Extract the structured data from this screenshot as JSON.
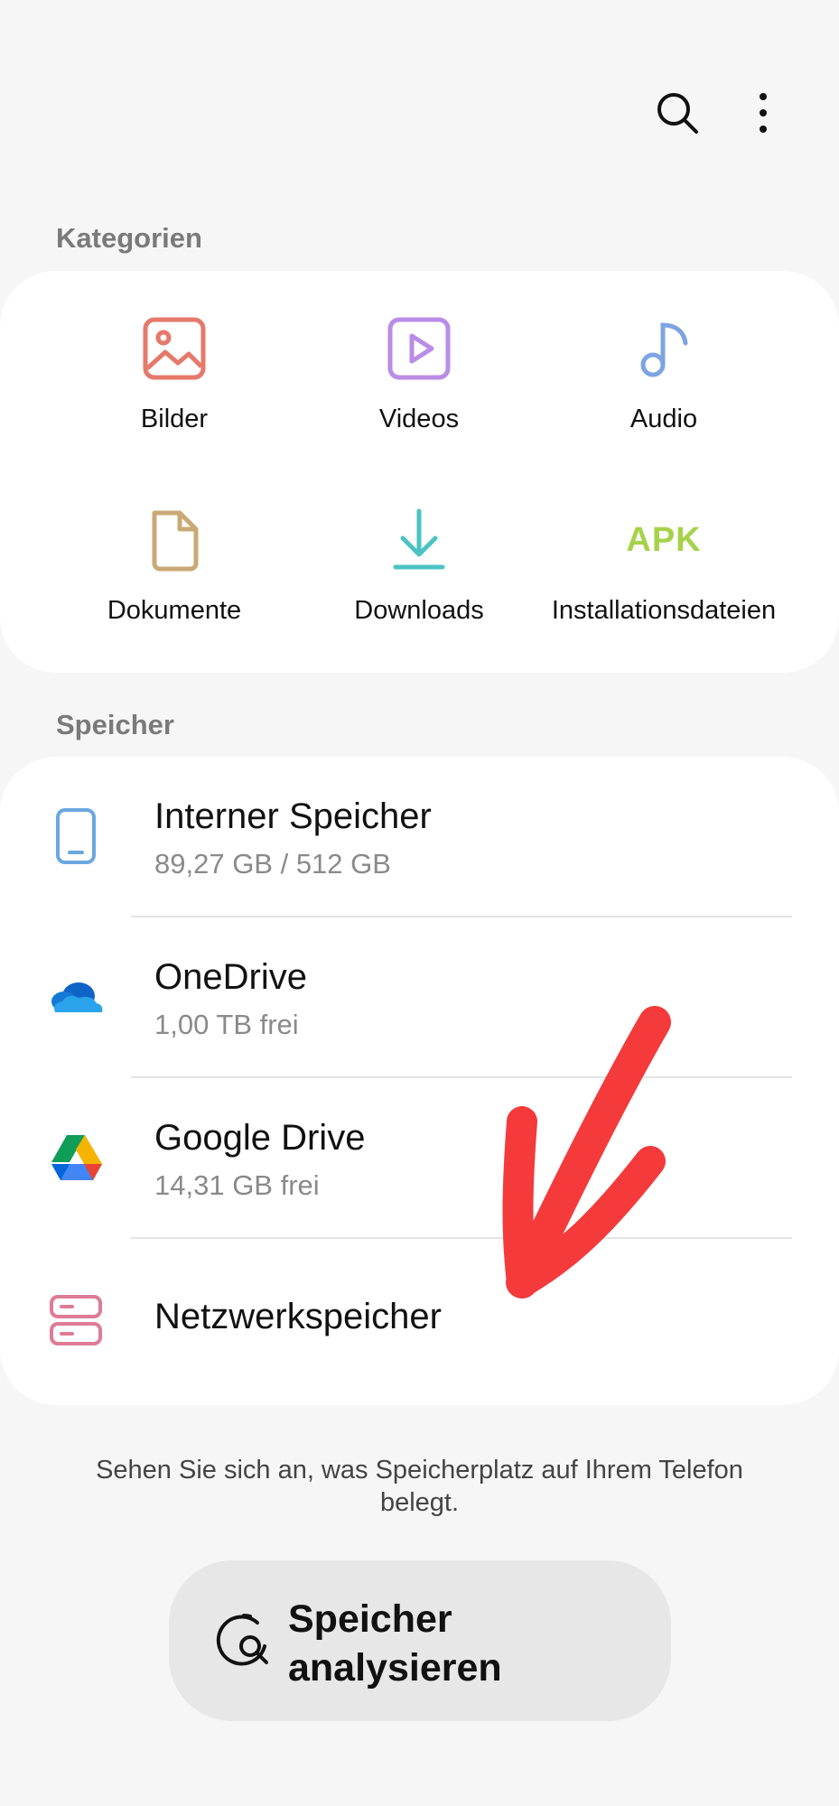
{
  "toolbar": {
    "search_icon": "search-icon",
    "more_icon": "more-vertical-icon"
  },
  "categories": {
    "label": "Kategorien",
    "items": [
      {
        "label": "Bilder",
        "icon": "image-icon",
        "color": "#e5796b"
      },
      {
        "label": "Videos",
        "icon": "video-icon",
        "color": "#b98ce6"
      },
      {
        "label": "Audio",
        "icon": "music-note-icon",
        "color": "#7da4e0"
      },
      {
        "label": "Dokumente",
        "icon": "document-icon",
        "color": "#c9a976"
      },
      {
        "label": "Downloads",
        "icon": "download-icon",
        "color": "#4cc3c3"
      },
      {
        "label": "Installationsdateien",
        "icon": "apk-icon",
        "icon_text": "APK",
        "color": "#a6d24a"
      }
    ]
  },
  "storage": {
    "label": "Speicher",
    "items": [
      {
        "title": "Interner Speicher",
        "subtitle": "89,27 GB / 512 GB",
        "icon": "phone-icon"
      },
      {
        "title": "OneDrive",
        "subtitle": "1,00 TB frei",
        "icon": "onedrive-icon"
      },
      {
        "title": "Google Drive",
        "subtitle": "14,31 GB frei",
        "icon": "google-drive-icon"
      },
      {
        "title": "Netzwerkspeicher",
        "icon": "network-storage-icon"
      }
    ]
  },
  "hint": "Sehen Sie sich an, was Speicherplatz auf Ihrem Telefon belegt.",
  "analyze_button": {
    "label": "Speicher analysieren",
    "icon": "storage-analyze-icon"
  },
  "annotation": {
    "icon": "red-arrow-annotation",
    "color": "#f43a3a"
  }
}
